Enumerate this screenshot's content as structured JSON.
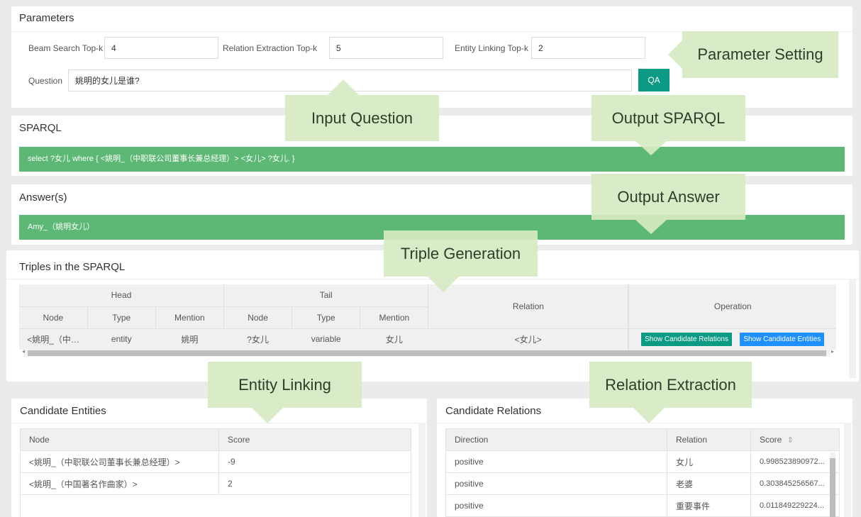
{
  "parameters": {
    "title": "Parameters",
    "beam_label": "Beam Search Top-k",
    "beam_value": "4",
    "relation_label": "Relation Extraction Top-k",
    "relation_value": "5",
    "entity_label": "Entity Linking Top-k",
    "entity_value": "2",
    "question_label": "Question",
    "question_value": "姚明的女儿是谁?",
    "qa_button": "QA"
  },
  "sparql": {
    "title": "SPARQL",
    "query": "select ?女儿 where { <姚明_（中职联公司董事长兼总经理）> <女儿> ?女儿. }"
  },
  "answers": {
    "title": "Answer(s)",
    "value": "Amy_（姚明女儿）"
  },
  "triples": {
    "title": "Triples in the SPARQL",
    "group_head": "Head",
    "group_tail": "Tail",
    "col_relation": "Relation",
    "col_operation": "Operation",
    "sub_headers": [
      "Node",
      "Type",
      "Mention",
      "Node",
      "Type",
      "Mention"
    ],
    "row": {
      "head_node": "<姚明_（中…",
      "head_type": "entity",
      "head_mention": "姚明",
      "tail_node": "?女儿",
      "tail_type": "variable",
      "tail_mention": "女儿",
      "relation": "<女儿>",
      "btn_relations": "Show Candidate Relations",
      "btn_entities": "Show Candidate Entities"
    }
  },
  "candidate_entities": {
    "title": "Candidate Entities",
    "col_node": "Node",
    "col_score": "Score",
    "rows": [
      {
        "node": "<姚明_（中职联公司董事长兼总经理）>",
        "score": "-9"
      },
      {
        "node": "<姚明_（中国著名作曲家）>",
        "score": "2"
      }
    ]
  },
  "candidate_relations": {
    "title": "Candidate Relations",
    "col_direction": "Direction",
    "col_relation": "Relation",
    "col_score": "Score",
    "sort_icon": "⇕",
    "rows": [
      {
        "direction": "positive",
        "relation": "女儿",
        "score": "0.998523890972..."
      },
      {
        "direction": "positive",
        "relation": "老婆",
        "score": "0.303845256567..."
      },
      {
        "direction": "positive",
        "relation": "重要事件",
        "score": "0.011849229224..."
      }
    ]
  },
  "callouts": {
    "parameter_setting": "Parameter Setting",
    "input_question": "Input Question",
    "output_sparql": "Output SPARQL",
    "output_answer": "Output Answer",
    "triple_generation": "Triple Generation",
    "entity_linking": "Entity Linking",
    "relation_extraction": "Relation Extraction"
  },
  "colors": {
    "green_bar": "#5cb874",
    "qa_button": "#0b9a83",
    "btn_relations": "#0b9a83",
    "btn_entities": "#1e90ff",
    "callout_bg": "#d7e9c2"
  }
}
